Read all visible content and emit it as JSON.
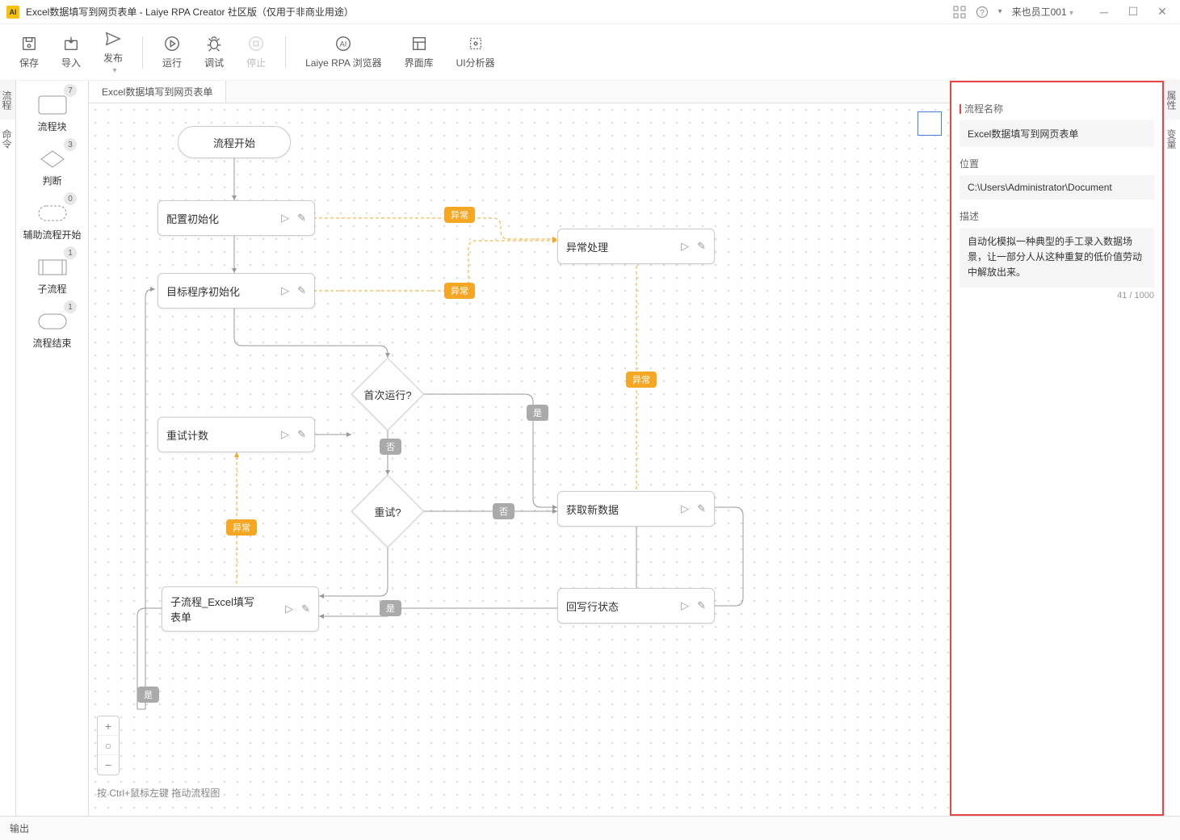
{
  "title": "Excel数据填写到网页表单 - Laiye RPA Creator 社区版（仅用于非商业用途）",
  "user": "来也员工001",
  "toolbar": {
    "save": "保存",
    "import": "导入",
    "publish": "发布",
    "run": "运行",
    "debug": "调试",
    "stop": "停止",
    "browser": "Laiye RPA 浏览器",
    "uilib": "界面库",
    "analyzer": "UI分析器"
  },
  "leftTabs": {
    "flow": "流程",
    "cmd": "命令"
  },
  "palette": {
    "block": {
      "label": "流程块",
      "count": "7"
    },
    "decision": {
      "label": "判断",
      "count": "3"
    },
    "substart": {
      "label": "辅助流程开始",
      "count": "0"
    },
    "subflow": {
      "label": "子流程",
      "count": "1"
    },
    "end": {
      "label": "流程结束",
      "count": "1"
    }
  },
  "tab": "Excel数据填写到网页表单",
  "nodes": {
    "start": "流程开始",
    "init": "配置初始化",
    "targetInit": "目标程序初始化",
    "firstRun": "首次运行?",
    "retryCount": "重试计数",
    "retry": "重试?",
    "subflowFill": "子流程_Excel填写表单",
    "exception": "异常处理",
    "getData": "获取新数据",
    "writeStatus": "回写行状态"
  },
  "labels": {
    "exception": "异常",
    "yes": "是",
    "no": "否"
  },
  "hint": "按 Ctrl+鼠标左键 拖动流程图",
  "rightTabs": {
    "props": "属性",
    "vars": "变量"
  },
  "props": {
    "nameLabel": "流程名称",
    "nameValue": "Excel数据填写到网页表单",
    "pathLabel": "位置",
    "pathValue": "C:\\Users\\Administrator\\Document",
    "descLabel": "描述",
    "descValue": "自动化模拟一种典型的手工录入数据场景，让一部分人从这种重复的低价值劳动中解放出来。",
    "charCount": "41 / 1000"
  },
  "output": "输出"
}
